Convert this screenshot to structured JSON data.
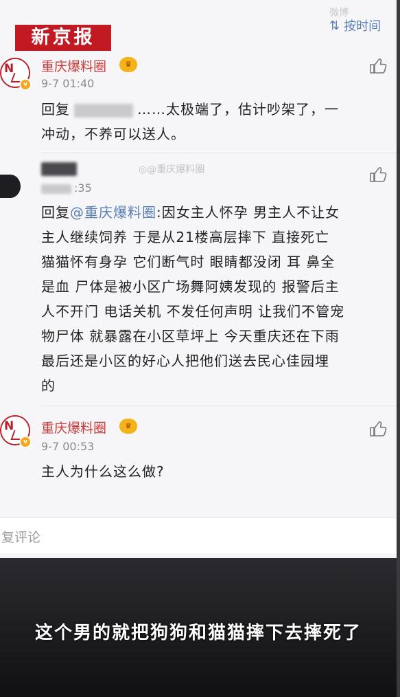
{
  "header": {
    "logo_text": "新京报",
    "top_watermark": "微博",
    "sort_label": "按时间"
  },
  "comments": [
    {
      "username": "重庆爆料圈",
      "vip_icon": "vip-crown-icon",
      "time": "9-7 01:40",
      "reply_prefix": "回复",
      "text_after_redaction": "……太极端了，估计吵架了，一",
      "text_line2": "冲动，不养可以送人。"
    },
    {
      "time_suffix": ":35",
      "watermark": "@重庆爆料圈",
      "reply_prefix": "回复",
      "mention": "@重庆爆料圈",
      "lines": [
        ":因女主人怀孕 男主人不让女",
        "主人继续饲养 于是从21楼高层摔下 直接死亡",
        "猫猫怀有身孕 它们断气时 眼睛都没闭 耳 鼻全",
        "是血 尸体是被小区广场舞阿姨发现的 报警后主",
        "人不开门 电话关机 不发任何声明 让我们不管宠",
        "物尸体 就暴露在小区草坪上 今天重庆还在下雨",
        "最后还是小区的好心人把他们送去民心佳园埋",
        "的"
      ]
    },
    {
      "username": "重庆爆料圈",
      "time": "9-7 00:53",
      "text": "主人为什么这么做?"
    }
  ],
  "input": {
    "placeholder": "复评论"
  },
  "subtitle": "这个男的就把狗狗和猫猫摔下去摔死了",
  "colors": {
    "logo_red": "#c21a22",
    "username_red": "#d03a3a",
    "link_blue": "#5a7fb5",
    "vip_gold": "#f5b31a"
  }
}
